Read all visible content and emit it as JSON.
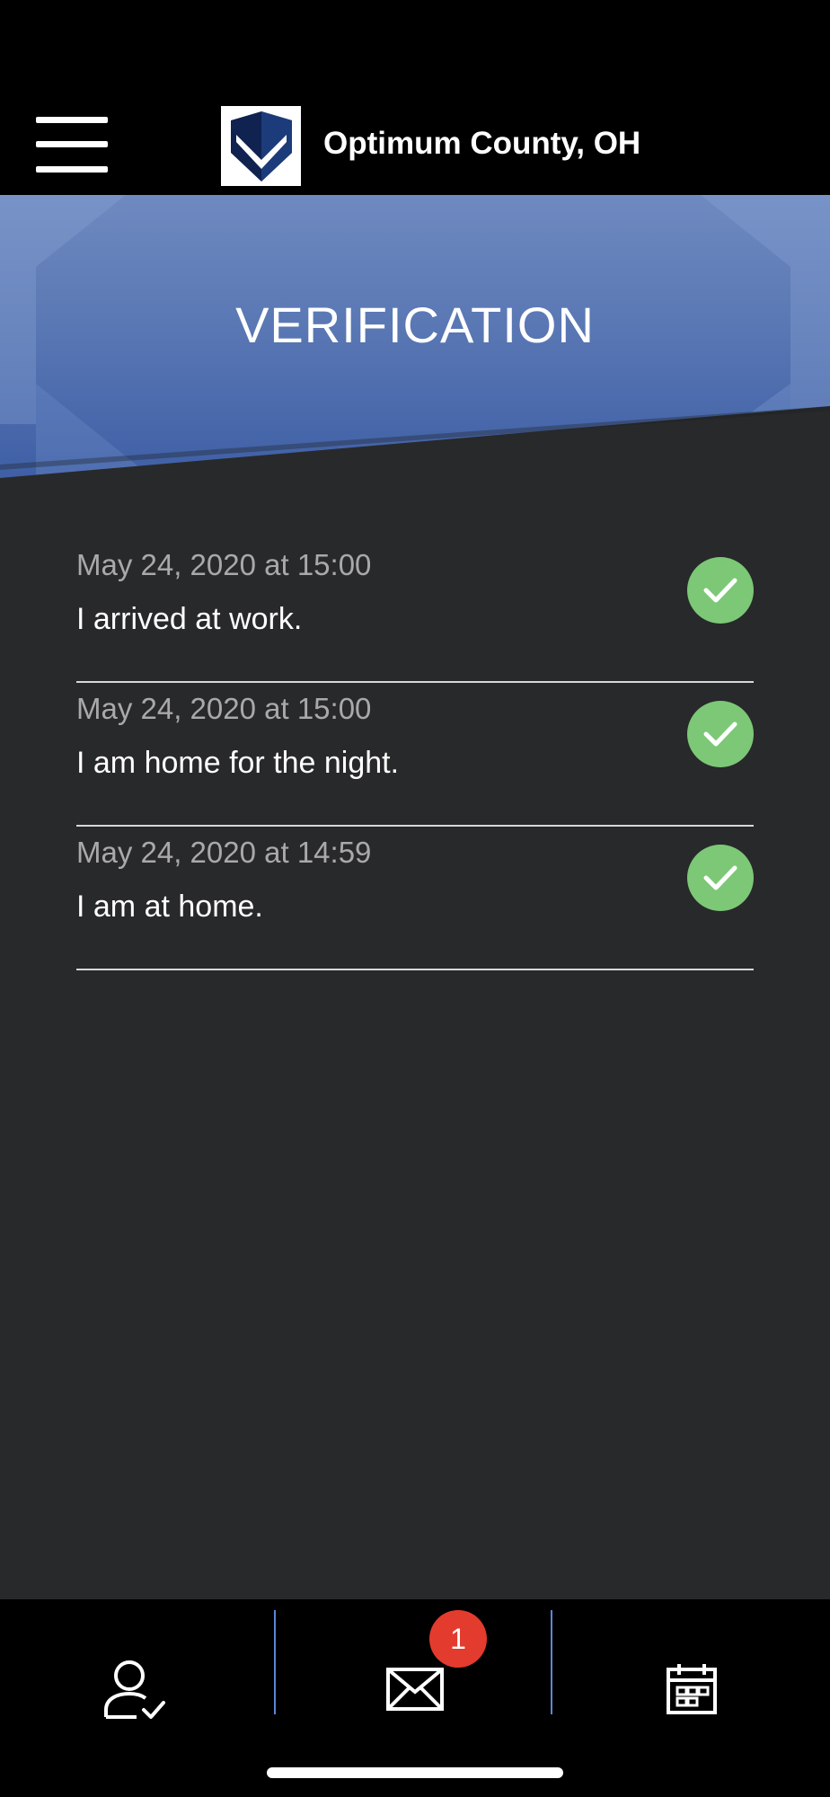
{
  "header": {
    "title": "Optimum County, OH",
    "menu_icon": "hamburger-menu-icon",
    "logo_icon": "shield-logo-icon"
  },
  "banner": {
    "title": "VERIFICATION"
  },
  "entries": [
    {
      "date": "May 24, 2020 at 15:00",
      "text": "I arrived at work.",
      "status_icon": "check-circle-icon"
    },
    {
      "date": "May 24, 2020 at 15:00",
      "text": "I am home for the night.",
      "status_icon": "check-circle-icon"
    },
    {
      "date": "May 24, 2020 at 14:59",
      "text": "I am at home.",
      "status_icon": "check-circle-icon"
    }
  ],
  "bottom_nav": {
    "items": [
      {
        "name": "verification",
        "icon": "user-check-icon"
      },
      {
        "name": "messages",
        "icon": "mail-icon",
        "badge": "1"
      },
      {
        "name": "calendar",
        "icon": "calendar-icon"
      }
    ]
  },
  "colors": {
    "banner": "#5a78b4",
    "check": "#7cc877",
    "badge": "#e33b2e",
    "divider": "#5b86d8",
    "background": "#28292a"
  }
}
